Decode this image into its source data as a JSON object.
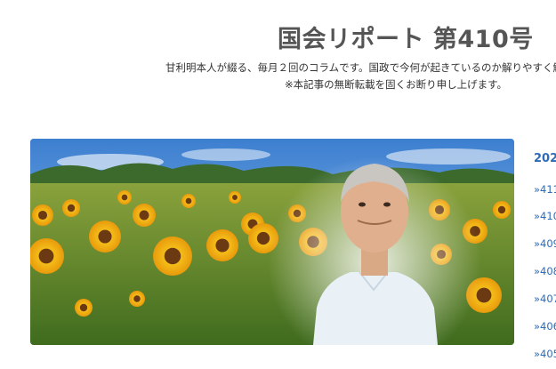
{
  "header": {
    "title": "国会リポート 第410号",
    "description": "甘利明本人が綴る、毎月２回のコラムです。国政で今何が起きているのか解りやすく解",
    "notice": "※本記事の無断転載を固くお断り申し上げます。"
  },
  "hero": {
    "image_description_icon": "sunflower-field-portrait-image"
  },
  "sidebar": {
    "year": "202",
    "issues": [
      "»411",
      "»410",
      "»409",
      "»408",
      "»407",
      "»406",
      "»405"
    ]
  },
  "colors": {
    "link": "#2e6bb8",
    "title": "#555555",
    "sky": "#5a9ad6"
  }
}
